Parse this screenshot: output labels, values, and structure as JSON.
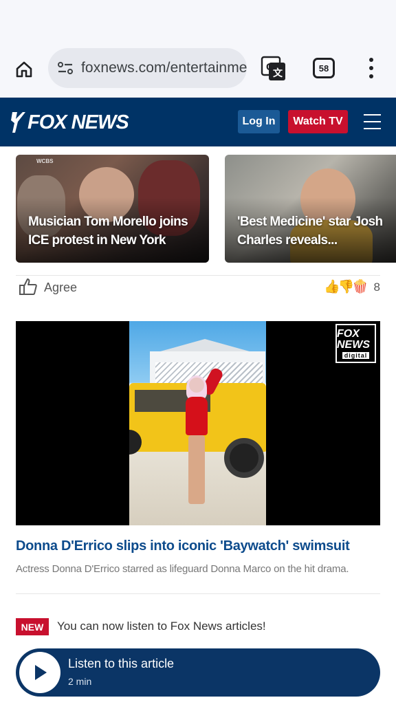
{
  "browser": {
    "url": "foxnews.com/entertainme",
    "tab_count": "58"
  },
  "header": {
    "logo_text": "FOX NEWS",
    "login_label": "Log In",
    "watch_label": "Watch TV",
    "colors": {
      "navy": "#003366",
      "red": "#c8102e",
      "login_blue": "#1b5a96"
    }
  },
  "carousel": [
    {
      "tag": "WCBS",
      "headline": "Musician Tom Morello joins ICE protest in New York"
    },
    {
      "tag": "",
      "headline": "'Best Medicine' star Josh Charles reveals..."
    }
  ],
  "reactions": {
    "agree_label": "Agree",
    "emojis": "👍👎🍿",
    "count": "8"
  },
  "video": {
    "logo_line1": "FOX NEWS",
    "logo_line2": "digital",
    "title": "Donna D'Errico slips into iconic 'Baywatch' swimsuit",
    "description": "Actress Donna D'Errico starred as lifeguard Donna Marco on the hit drama."
  },
  "listen": {
    "badge": "NEW",
    "notice": "You can now listen to Fox News articles!",
    "title": "Listen to this article",
    "duration": "2 min"
  }
}
